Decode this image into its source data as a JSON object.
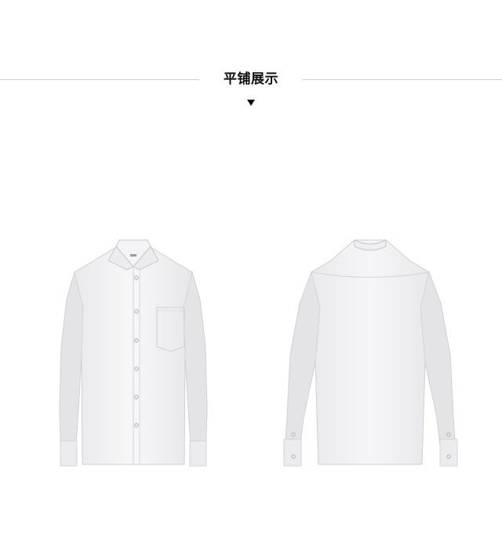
{
  "section": {
    "title": "平铺展示"
  },
  "images": {
    "front_shirt": "white-dress-shirt-front",
    "back_shirt": "white-dress-shirt-back"
  },
  "colors": {
    "background": "#ffffff",
    "line": "#cfcfcf",
    "title": "#111111",
    "shirt_fill": "#f2f2f4",
    "shirt_shade": "#dcdcdf"
  }
}
